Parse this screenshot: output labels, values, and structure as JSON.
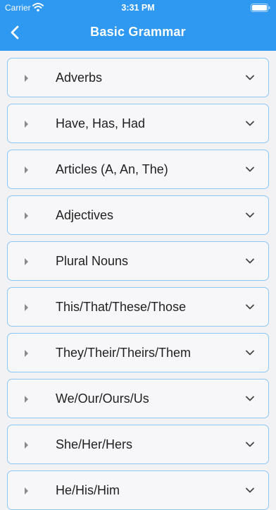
{
  "status_bar": {
    "carrier": "Carrier",
    "time": "3:31 PM",
    "icons": [
      "wifi-icon",
      "battery-icon"
    ]
  },
  "nav": {
    "title": "Basic Grammar",
    "back_icon": "chevron-left-icon"
  },
  "colors": {
    "header": "#2f98f1",
    "card_border": "#8cc7f5",
    "background": "#f2f2f4"
  },
  "topics": [
    {
      "label": "Adverbs"
    },
    {
      "label": "Have, Has, Had"
    },
    {
      "label": "Articles (A, An, The)"
    },
    {
      "label": "Adjectives"
    },
    {
      "label": "Plural Nouns"
    },
    {
      "label": "This/That/These/Those"
    },
    {
      "label": "They/Their/Theirs/Them"
    },
    {
      "label": "We/Our/Ours/Us"
    },
    {
      "label": "She/Her/Hers"
    },
    {
      "label": "He/His/Him"
    }
  ]
}
